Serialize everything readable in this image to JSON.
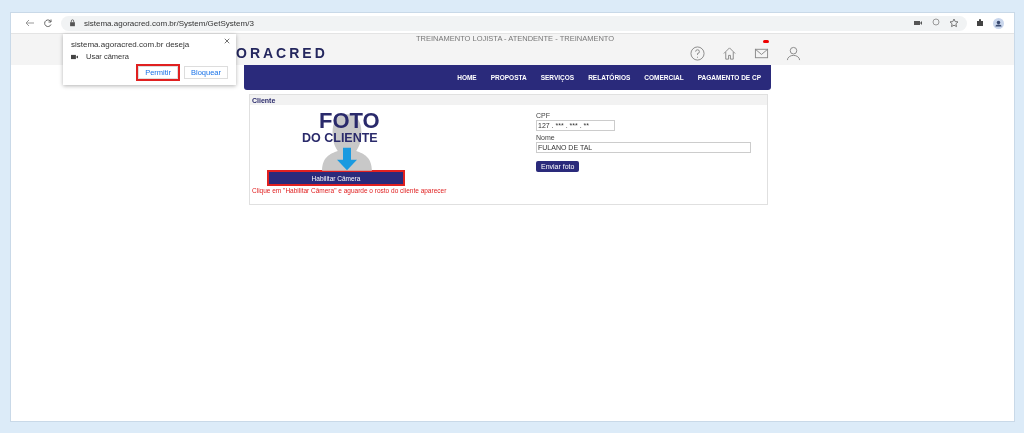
{
  "browser": {
    "url": "sistema.agoracred.com.br/System/GetSystem/3"
  },
  "permission_popup": {
    "message": "sistema.agoracred.com.br deseja",
    "permission": "Usar câmera",
    "buttons": [
      {
        "label": "Permitir",
        "highlighted": true
      },
      {
        "label": "Bloquear",
        "highlighted": false
      }
    ]
  },
  "header": {
    "logo": "ORACRED",
    "session": "TREINAMENTO LOJISTA - ATENDENTE - TREINAMENTO",
    "mail_unread": true
  },
  "nav": [
    "HOME",
    "PROPOSTA",
    "SERVIÇOS",
    "RELATÓRIOS",
    "COMERCIAL",
    "PAGAMENTO DE CP"
  ],
  "panel": {
    "title": "Cliente",
    "photo_line_1": "FOTO",
    "photo_line_2": "DO CLIENTE",
    "camera_button": {
      "label": "Habilitar Câmera",
      "highlighted": true
    },
    "hint": "Clique em \"Habilitar Câmera\" e aguarde o rosto do cliente aparecer",
    "cpf_label": "CPF",
    "cpf_value": "127 . *** . *** . **",
    "name_label": "Nome",
    "name_value": "FULANO DE TAL",
    "send_button": "Enviar foto"
  }
}
